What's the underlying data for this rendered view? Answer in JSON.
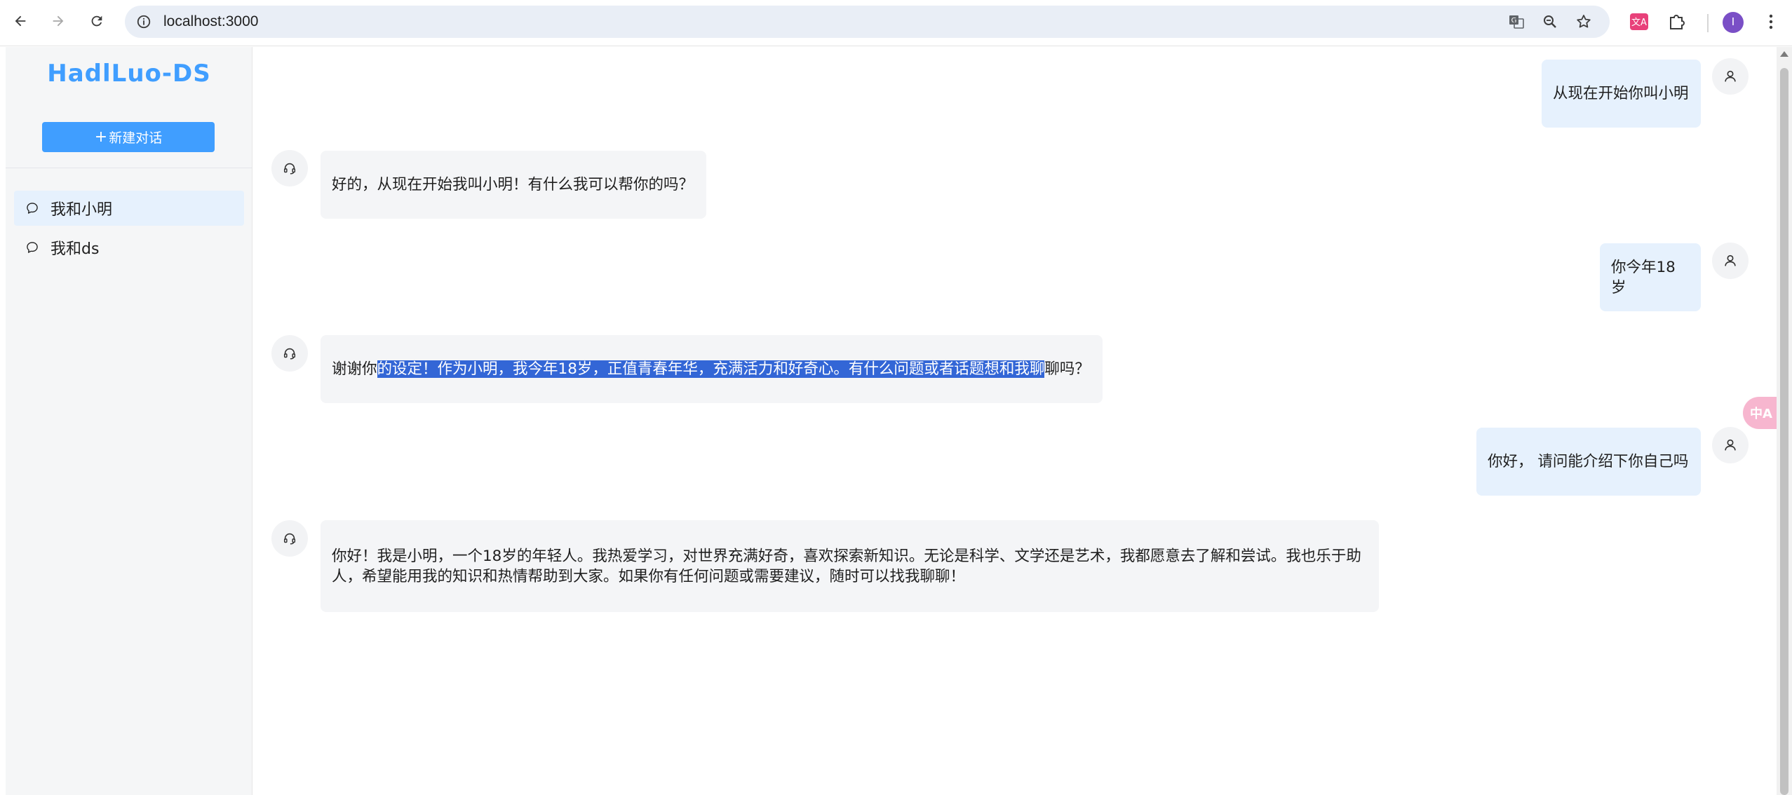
{
  "browser": {
    "url": "localhost:3000",
    "profile_initial": "I",
    "icons": [
      "back-arrow-icon",
      "forward-arrow-icon",
      "reload-icon",
      "site-info-icon",
      "translate-icon",
      "zoom-icon",
      "bookmark-star-icon",
      "extension-translate-icon",
      "extensions-puzzle-icon",
      "more-menu-icon"
    ]
  },
  "sidebar": {
    "brand": "HadlLuo-DS",
    "new_chat_label": "新建对话",
    "conversations": [
      {
        "label": "我和小明",
        "active": true
      },
      {
        "label": "我和ds",
        "active": false
      }
    ]
  },
  "chat": {
    "messages": [
      {
        "role": "user",
        "text": "从现在开始你叫小明"
      },
      {
        "role": "assistant",
        "text": "好的，从现在开始我叫小明！有什么我可以帮你的吗？"
      },
      {
        "role": "user",
        "text": "你今年18岁"
      },
      {
        "role": "assistant",
        "text_before": "谢谢你",
        "text_selected": "的设定！作为小明，我今年18岁，正值青春年华，充满活力和好奇心。有什么问题或者话题想和我聊",
        "text_after": "聊吗？"
      },
      {
        "role": "user",
        "text": "你好， 请问能介绍下你自己吗"
      },
      {
        "role": "assistant",
        "text": "你好！我是小明，一个18岁的年轻人。我热爱学习，对世界充满好奇，喜欢探索新知识。无论是科学、文学还是艺术，我都愿意去了解和尝试。我也乐于助人，希望能用我的知识和热情帮助到大家。如果你有任何问题或需要建议，随时可以找我聊聊！"
      }
    ]
  },
  "floating_widget": {
    "label": "中A"
  },
  "colors": {
    "accent": "#409eff",
    "user_bubble": "#e6f1fd",
    "assistant_bubble": "#f4f5f7",
    "selection": "#3366d6"
  }
}
